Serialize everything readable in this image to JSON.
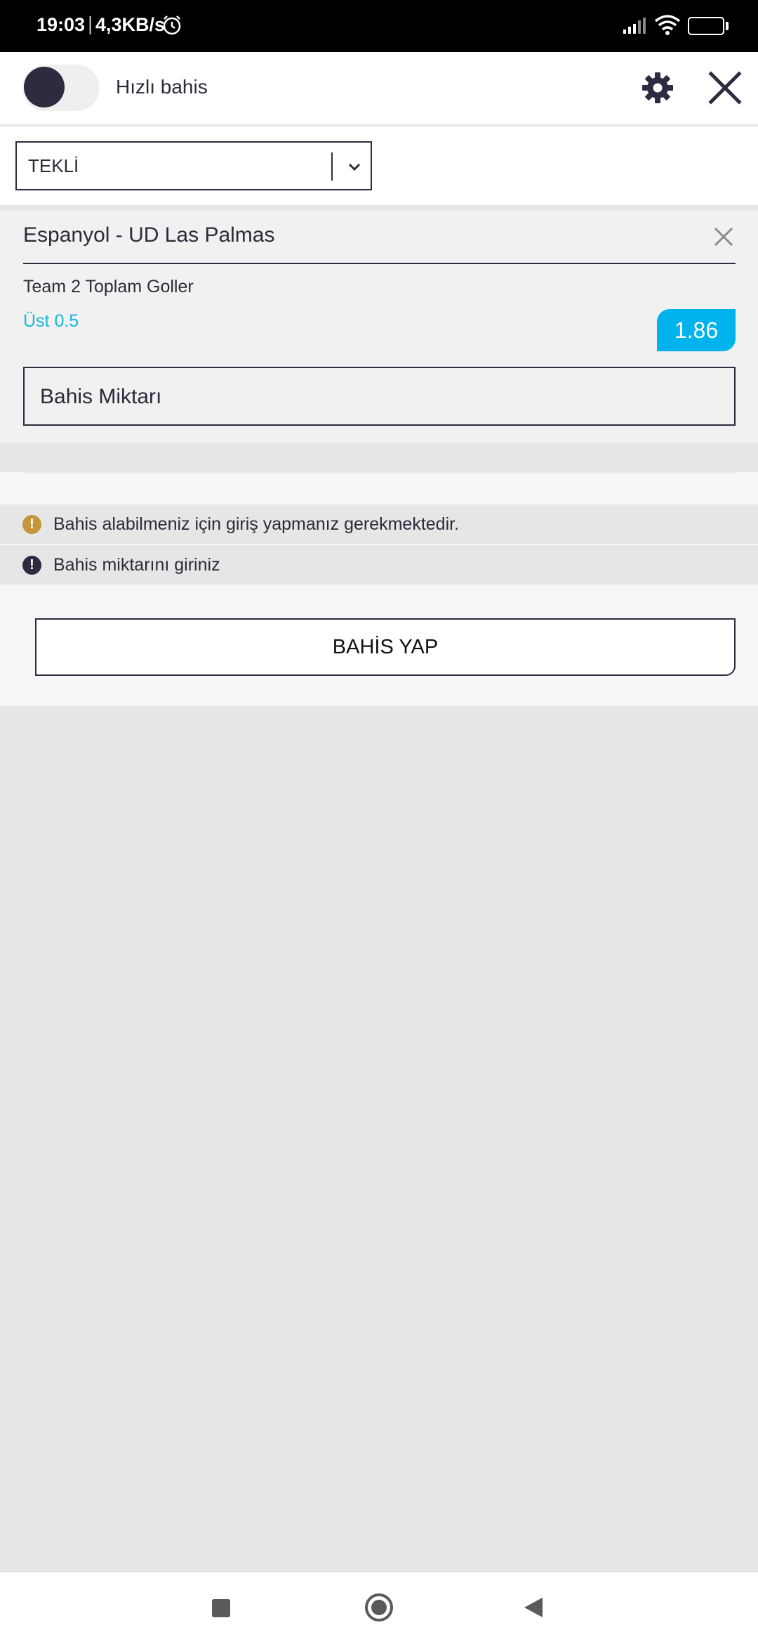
{
  "status_bar": {
    "time": "19:03",
    "separator": "|",
    "speed": "4,3KB/s",
    "battery": "64",
    "battery_level": 0.64,
    "icons": [
      "alarm-icon",
      "signal-icon",
      "wifi-icon",
      "battery-icon"
    ]
  },
  "header": {
    "toggle_label": "Hızlı bahis",
    "toggle_on": false,
    "settings_icon": "gear-icon",
    "close_icon": "close-icon"
  },
  "bet_type": {
    "selected": "TEKLİ",
    "icon": "chevron-down-icon"
  },
  "selection": {
    "match": "Espanyol - UD Las Palmas",
    "market": "Team 2 Toplam Goller",
    "pick": "Üst 0.5",
    "odds": "1.86",
    "stake_placeholder": "Bahis Miktarı"
  },
  "messages": [
    {
      "text": "Bahis alabilmeniz için giriş yapmanız gerekmektedir.",
      "icon": "warning-icon",
      "color": "#c4963b"
    },
    {
      "text": "Bahis miktarını giriniz",
      "icon": "error-icon",
      "color": "#2d2b3f"
    }
  ],
  "actions": {
    "place_bet": "BAHİS YAP"
  },
  "colors": {
    "accent": "#00b3ec",
    "pick_text": "#17b8dc",
    "dark": "#2d2b3f"
  },
  "nav_bar": {
    "icons": [
      "recent-apps-icon",
      "home-icon",
      "back-icon"
    ]
  }
}
